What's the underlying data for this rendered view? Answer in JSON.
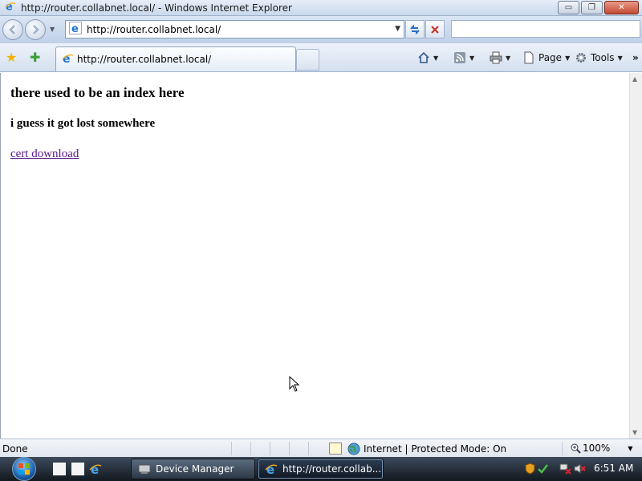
{
  "window": {
    "title": "http://router.collabnet.local/ - Windows Internet Explorer",
    "controls": {
      "minimize": "▭",
      "maximize": "❐",
      "close": "✕"
    }
  },
  "address_bar": {
    "url": "http://router.collabnet.local/",
    "search_value": ""
  },
  "tab": {
    "label": "http://router.collabnet.local/"
  },
  "command_bar": {
    "page_label": "Page",
    "tools_label": "Tools",
    "more": "»"
  },
  "page": {
    "heading": "there used to be an index here",
    "subheading": "i guess it got lost somewhere",
    "link": "cert download"
  },
  "status_bar": {
    "status": "Done",
    "zone": "Internet | Protected Mode: On",
    "zoom": "100%"
  },
  "taskbar": {
    "buttons": [
      {
        "label": "Device Manager"
      },
      {
        "label": "http://router.collab..."
      }
    ],
    "clock": "6:51 AM"
  },
  "colors": {
    "link_visited": "#551a8b",
    "chrome_blue": "#c9d8ec",
    "taskbar_dark": "#12181f"
  },
  "icons": {
    "browser": "ie-icon",
    "favorites": "star-icon",
    "add_favorite": "add-favorite-icon",
    "home": "home-icon",
    "feeds": "rss-icon",
    "print": "printer-icon",
    "page": "page-icon",
    "tools": "gear-icon"
  }
}
